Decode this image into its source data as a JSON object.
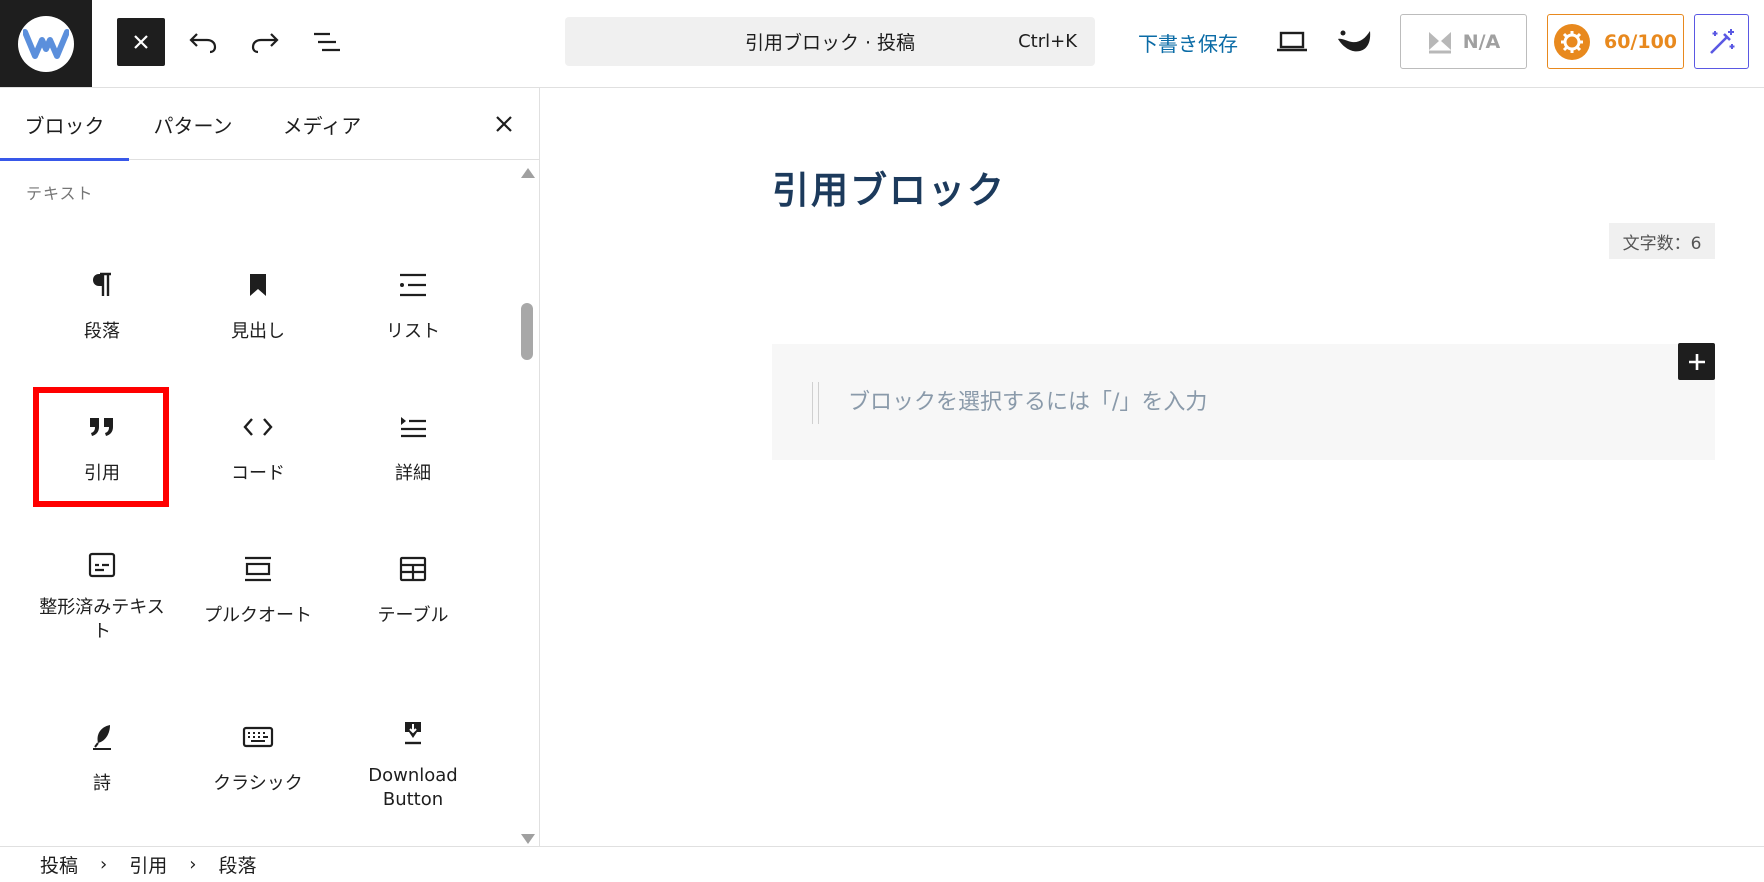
{
  "toolbar": {
    "command_title": "引用ブロック · 投稿",
    "command_shortcut": "Ctrl+K",
    "save_draft": "下書き保存",
    "na_label": "N/A",
    "score_label": "60/100"
  },
  "sidebar": {
    "tabs": [
      {
        "label": "ブロック"
      },
      {
        "label": "パターン"
      },
      {
        "label": "メディア"
      }
    ],
    "category": "テキスト",
    "blocks": [
      {
        "label": "段落",
        "icon": "paragraph-icon"
      },
      {
        "label": "見出し",
        "icon": "bookmark-icon"
      },
      {
        "label": "リスト",
        "icon": "list-icon"
      },
      {
        "label": "引用",
        "icon": "quote-icon"
      },
      {
        "label": "コード",
        "icon": "code-icon"
      },
      {
        "label": "詳細",
        "icon": "details-icon"
      },
      {
        "label": "整形済みテキスト",
        "icon": "preformatted-icon"
      },
      {
        "label": "プルクオート",
        "icon": "pullquote-icon"
      },
      {
        "label": "テーブル",
        "icon": "table-icon"
      },
      {
        "label": "詩",
        "icon": "verse-icon"
      },
      {
        "label": "クラシック",
        "icon": "keyboard-icon"
      },
      {
        "label": "Download Button",
        "icon": "download-icon"
      }
    ]
  },
  "editor": {
    "post_title": "引用ブロック",
    "char_count": "文字数：6",
    "quote_placeholder": "ブロックを選択するには「/」を入力"
  },
  "breadcrumb": [
    {
      "label": "投稿"
    },
    {
      "label": "引用"
    },
    {
      "label": "段落"
    }
  ],
  "colors": {
    "accent": "#3858e9",
    "link": "#0a6ba6",
    "score": "#e8891e",
    "highlight": "#ff0000",
    "title": "#1c3a5c"
  }
}
